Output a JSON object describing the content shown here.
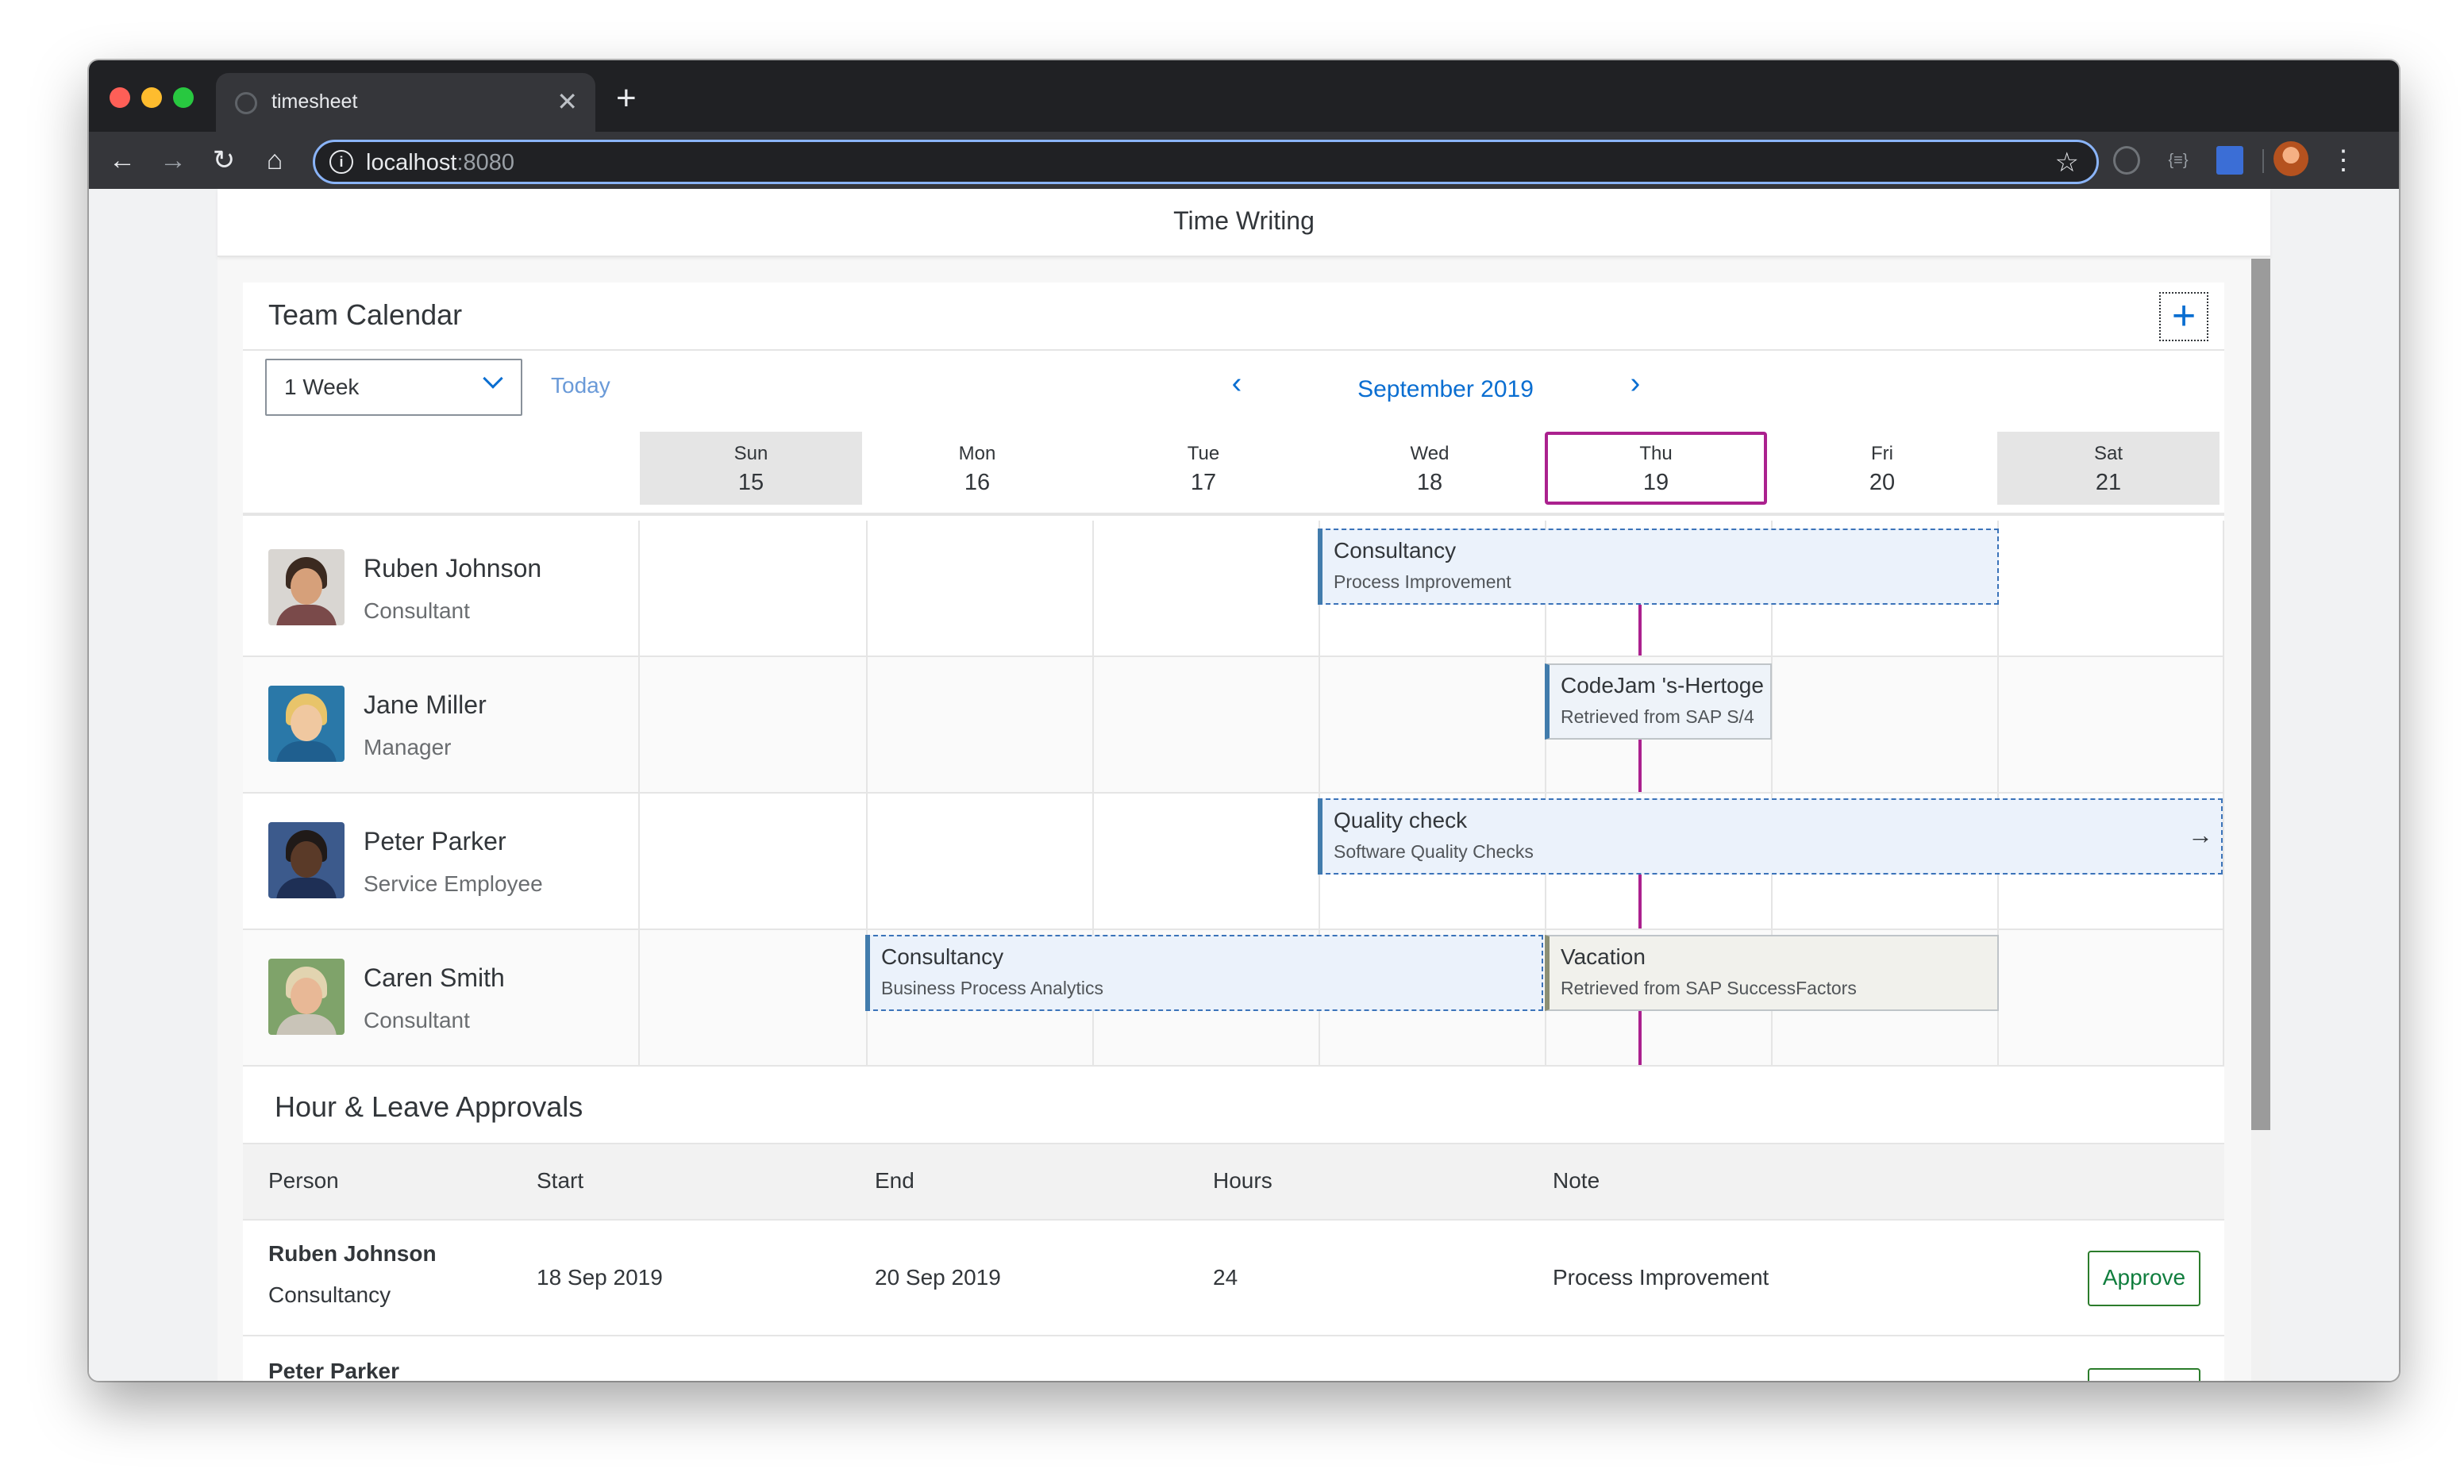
{
  "browser": {
    "tab_title": "timesheet",
    "url_host": "localhost",
    "url_port": ":8080"
  },
  "shell": {
    "title": "Time Writing"
  },
  "calendar": {
    "title": "Team Calendar",
    "view_option": "1 Week",
    "today_label": "Today",
    "month": "September 2019",
    "days": [
      {
        "name": "Sun",
        "num": "15"
      },
      {
        "name": "Mon",
        "num": "16"
      },
      {
        "name": "Tue",
        "num": "17"
      },
      {
        "name": "Wed",
        "num": "18"
      },
      {
        "name": "Thu",
        "num": "19"
      },
      {
        "name": "Fri",
        "num": "20"
      },
      {
        "name": "Sat",
        "num": "21"
      }
    ],
    "people": [
      {
        "name": "Ruben Johnson",
        "role": "Consultant",
        "appointments": [
          {
            "title": "Consultancy",
            "subtitle": "Process Improvement"
          }
        ]
      },
      {
        "name": "Jane Miller",
        "role": "Manager",
        "appointments": [
          {
            "title": "CodeJam 's-Hertoge",
            "subtitle": "Retrieved from SAP S/4"
          }
        ]
      },
      {
        "name": "Peter Parker",
        "role": "Service Employee",
        "appointments": [
          {
            "title": "Quality check",
            "subtitle": "Software Quality Checks"
          }
        ]
      },
      {
        "name": "Caren Smith",
        "role": "Consultant",
        "appointments": [
          {
            "title": "Consultancy",
            "subtitle": "Business Process Analytics"
          },
          {
            "title": "Vacation",
            "subtitle": "Retrieved from SAP SuccessFactors"
          }
        ]
      }
    ]
  },
  "approvals": {
    "title": "Hour & Leave Approvals",
    "columns": [
      "Person",
      "Start",
      "End",
      "Hours",
      "Note"
    ],
    "rows": [
      {
        "person": "Ruben Johnson",
        "type": "Consultancy",
        "start": "18 Sep 2019",
        "end": "20 Sep 2019",
        "hours": "24",
        "note": "Process Improvement",
        "action": "Approve"
      },
      {
        "person": "Peter Parker",
        "type": "",
        "start": "",
        "end": "",
        "hours": "",
        "note": "",
        "action": ""
      }
    ]
  }
}
